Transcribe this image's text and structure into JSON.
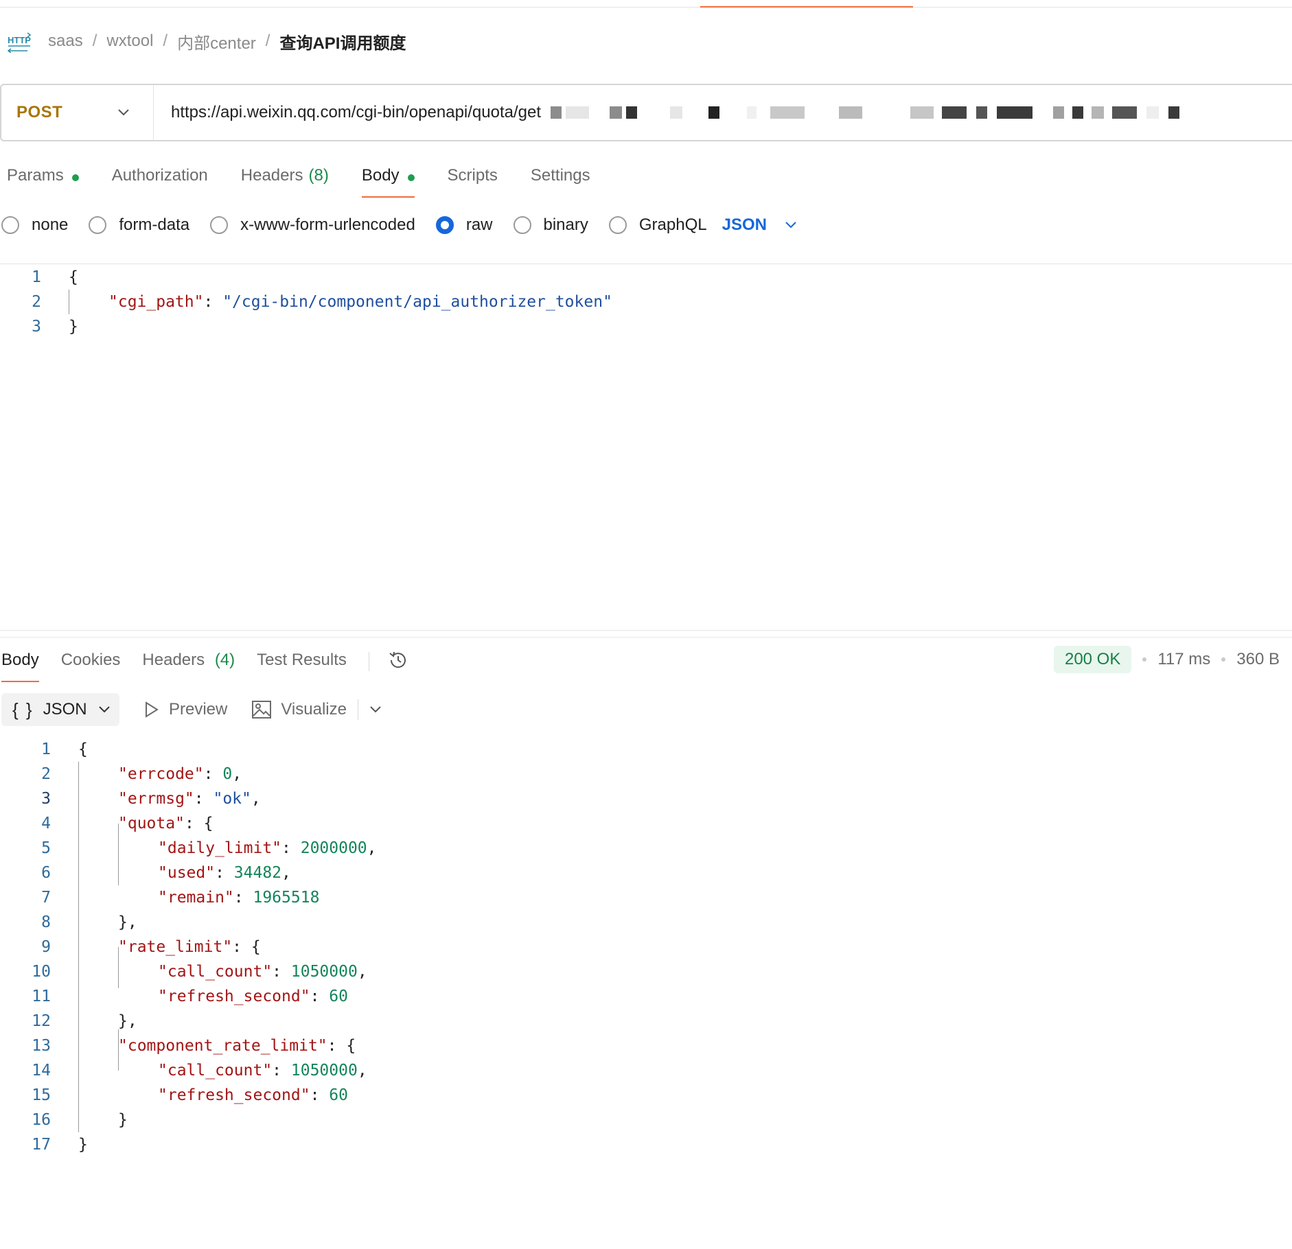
{
  "breadcrumb": {
    "icon": "http-icon",
    "items": [
      "saas",
      "wxtool",
      "内部center"
    ],
    "current": "查询API调用额度"
  },
  "request": {
    "method": "POST",
    "url": "https://api.weixin.qq.com/cgi-bin/openapi/quota/get"
  },
  "req_tabs": {
    "params": "Params",
    "authorization": "Authorization",
    "headers": "Headers",
    "headers_count": "(8)",
    "body": "Body",
    "scripts": "Scripts",
    "settings": "Settings"
  },
  "body_types": {
    "none": "none",
    "form_data": "form-data",
    "urlencoded": "x-www-form-urlencoded",
    "raw": "raw",
    "binary": "binary",
    "graphql": "GraphQL",
    "selected": "raw",
    "language": "JSON"
  },
  "request_body": {
    "line_numbers": [
      "1",
      "2",
      "3"
    ],
    "open": "{",
    "key": "\"cgi_path\"",
    "colon": ": ",
    "value": "\"/cgi-bin/component/api_authorizer_token\"",
    "close": "}"
  },
  "res_tabs": {
    "body": "Body",
    "cookies": "Cookies",
    "headers": "Headers",
    "headers_count": "(4)",
    "test_results": "Test Results"
  },
  "status": {
    "code": "200 OK",
    "time": "117 ms",
    "size": "360 B"
  },
  "res_toolbar": {
    "format_icon": "{ }",
    "format": "JSON",
    "preview": "Preview",
    "visualize": "Visualize"
  },
  "response_body": {
    "line_numbers": [
      "1",
      "2",
      "3",
      "4",
      "5",
      "6",
      "7",
      "8",
      "9",
      "10",
      "11",
      "12",
      "13",
      "14",
      "15",
      "16",
      "17"
    ],
    "open": "{",
    "close": "}",
    "close_comma": "},",
    "colon": ": ",
    "colon_brace": ": {",
    "comma": ",",
    "errcode_key": "\"errcode\"",
    "errcode_val": "0",
    "errmsg_key": "\"errmsg\"",
    "errmsg_val": "\"ok\"",
    "quota_key": "\"quota\"",
    "daily_limit_key": "\"daily_limit\"",
    "daily_limit_val": "2000000",
    "used_key": "\"used\"",
    "used_val": "34482",
    "remain_key": "\"remain\"",
    "remain_val": "1965518",
    "rate_limit_key": "\"rate_limit\"",
    "call_count_key": "\"call_count\"",
    "call_count_val": "1050000",
    "refresh_second_key": "\"refresh_second\"",
    "refresh_second_val": "60",
    "component_rate_limit_key": "\"component_rate_limit\""
  },
  "colors": {
    "accent": "#f26b3a",
    "method": "#a87608",
    "radio_checked": "#1667d9",
    "status_ok_bg": "#e8f6ee",
    "status_ok_text": "#1a7f44",
    "json_key": "#a31515",
    "json_string": "#1f4f9e",
    "json_number": "#13855a"
  }
}
